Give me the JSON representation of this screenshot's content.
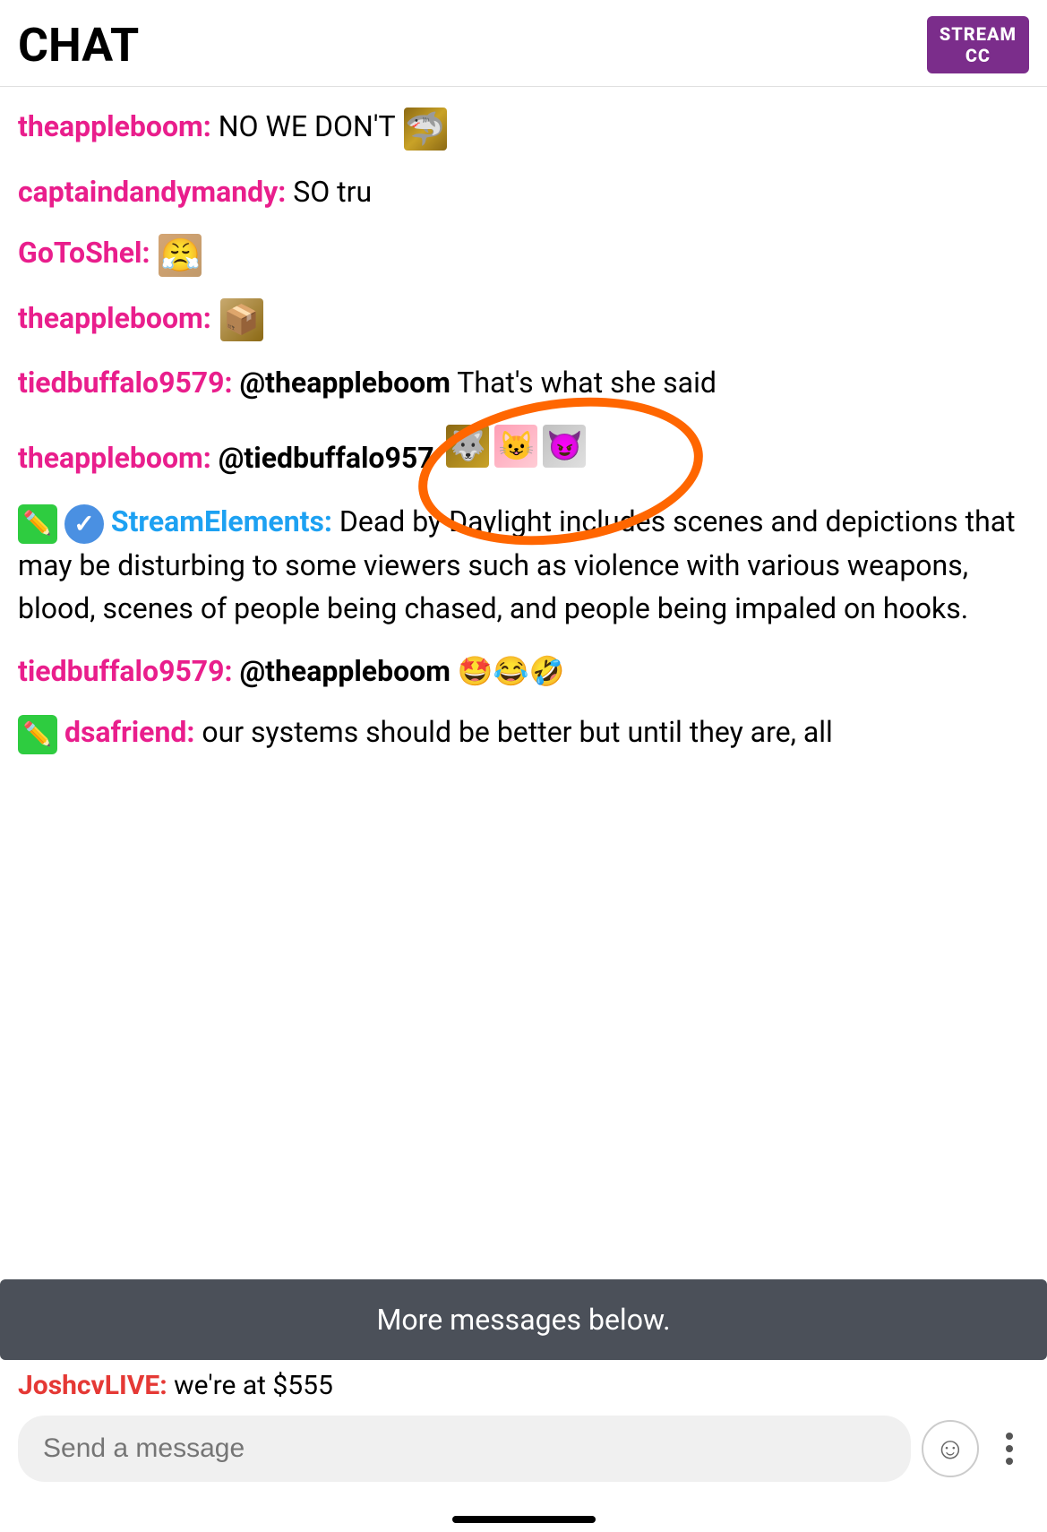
{
  "header": {
    "title": "CHAT",
    "badge": {
      "line1": "STREAM",
      "line2": "CC"
    }
  },
  "messages": [
    {
      "id": 1,
      "username": "theappleboom",
      "username_color": "pink",
      "text": "NO WE DON'T",
      "has_emote": true,
      "emote_type": "shark"
    },
    {
      "id": 2,
      "username": "captaindandymandy",
      "username_color": "pink",
      "text": "SO tru",
      "has_emote": false
    },
    {
      "id": 3,
      "username": "GoToShel",
      "username_color": "pink",
      "text": "",
      "has_emote": true,
      "emote_type": "man"
    },
    {
      "id": 4,
      "username": "theappleboom",
      "username_color": "pink",
      "text": "",
      "has_emote": true,
      "emote_type": "wrapped"
    },
    {
      "id": 5,
      "username": "tiedbuffalo9579",
      "username_color": "pink",
      "text": "@theappleboom That's what she said",
      "has_emote": false
    },
    {
      "id": 6,
      "username": "theappleboom",
      "username_color": "pink",
      "text": "@tiedbuffalo957",
      "has_emote": true,
      "emote_type": "circled",
      "has_circle": true
    },
    {
      "id": 7,
      "type": "stream_elements",
      "username": "StreamElements",
      "text": "Dead by Daylight includes scenes and depictions that may be disturbing to some viewers such as violence with various weapons, blood, scenes of people being chased, and people being impaled on hooks."
    },
    {
      "id": 8,
      "username": "tiedbuffalo9579",
      "username_color": "pink",
      "text": "@theappleboom 🤩😂🤣",
      "has_emote": false
    },
    {
      "id": 9,
      "type": "with_badge",
      "username": "dsafriend",
      "username_color": "green_badge",
      "text": "our systems should be better but until they are, all"
    }
  ],
  "more_messages_bar": {
    "text": "More messages below."
  },
  "last_message": {
    "username": "JoshcvLIVE",
    "username_color": "red",
    "text": "we're at $555"
  },
  "input": {
    "placeholder": "Send a message"
  },
  "nav_bar": {
    "visible": true
  }
}
